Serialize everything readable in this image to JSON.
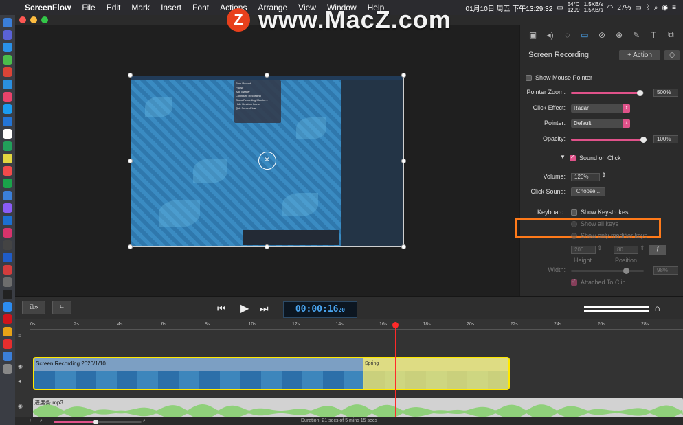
{
  "menubar": {
    "app": "ScreenFlow",
    "items": [
      "File",
      "Edit",
      "Mark",
      "Insert",
      "Font",
      "Actions",
      "Arrange",
      "View",
      "Window",
      "Help"
    ],
    "cpu": "54°C",
    "fan": "1299",
    "net_up": "1.5KB/s",
    "net_down": "1.5KB/s",
    "battery": "27%",
    "clock": "01月10日 周五 下午13:29:32"
  },
  "watermark": {
    "logo": "Z",
    "text": "www.MacZ.com"
  },
  "inspector": {
    "title": "Screen Recording",
    "action_button": "+ Action",
    "show_mouse_pointer": "Show Mouse Pointer",
    "pointer_zoom_label": "Pointer Zoom:",
    "pointer_zoom_value": "500%",
    "pointer_zoom_level": 0.95,
    "click_effect_label": "Click Effect:",
    "click_effect_value": "Radar",
    "pointer_label": "Pointer:",
    "pointer_value": "Default",
    "opacity_label": "Opacity:",
    "opacity_value": "100%",
    "opacity_level": 1.0,
    "sound_on_click": "Sound on Click",
    "volume_label": "Volume:",
    "volume_value": "120%",
    "click_sound_label": "Click Sound:",
    "click_sound_button": "Choose...",
    "keyboard_label": "Keyboard:",
    "show_keystrokes": "Show Keystrokes",
    "show_all_keys": "Show all keys",
    "show_modifier_keys": "Show only modifier keys",
    "height_value": "200",
    "position_value": "80",
    "height_label": "Height",
    "position_label": "Position",
    "width_label": "Width:",
    "width_value": "98%",
    "attached_to_clip": "Attached To Clip"
  },
  "transport": {
    "timecode": "00:00:16",
    "frames": "20"
  },
  "timeline": {
    "ticks": [
      "0s",
      "2s",
      "4s",
      "6s",
      "8s",
      "10s",
      "12s",
      "14s",
      "16s",
      "18s",
      "20s",
      "22s",
      "24s",
      "26s",
      "28s"
    ],
    "video_clip_label": "Screen Recording 2020/1/10",
    "spring_label": "Spring",
    "audio_clip_label": "进度条.mp3",
    "duration": "Duration: 21 secs of 5 mins 15 secs"
  },
  "preview_menu": {
    "items": [
      "Stop Record",
      "Pause",
      "Add Marker",
      "Configure Recording",
      "Show Recording Monitor...",
      "Hide Desktop Icons",
      "Quit ScreenFlow"
    ]
  }
}
